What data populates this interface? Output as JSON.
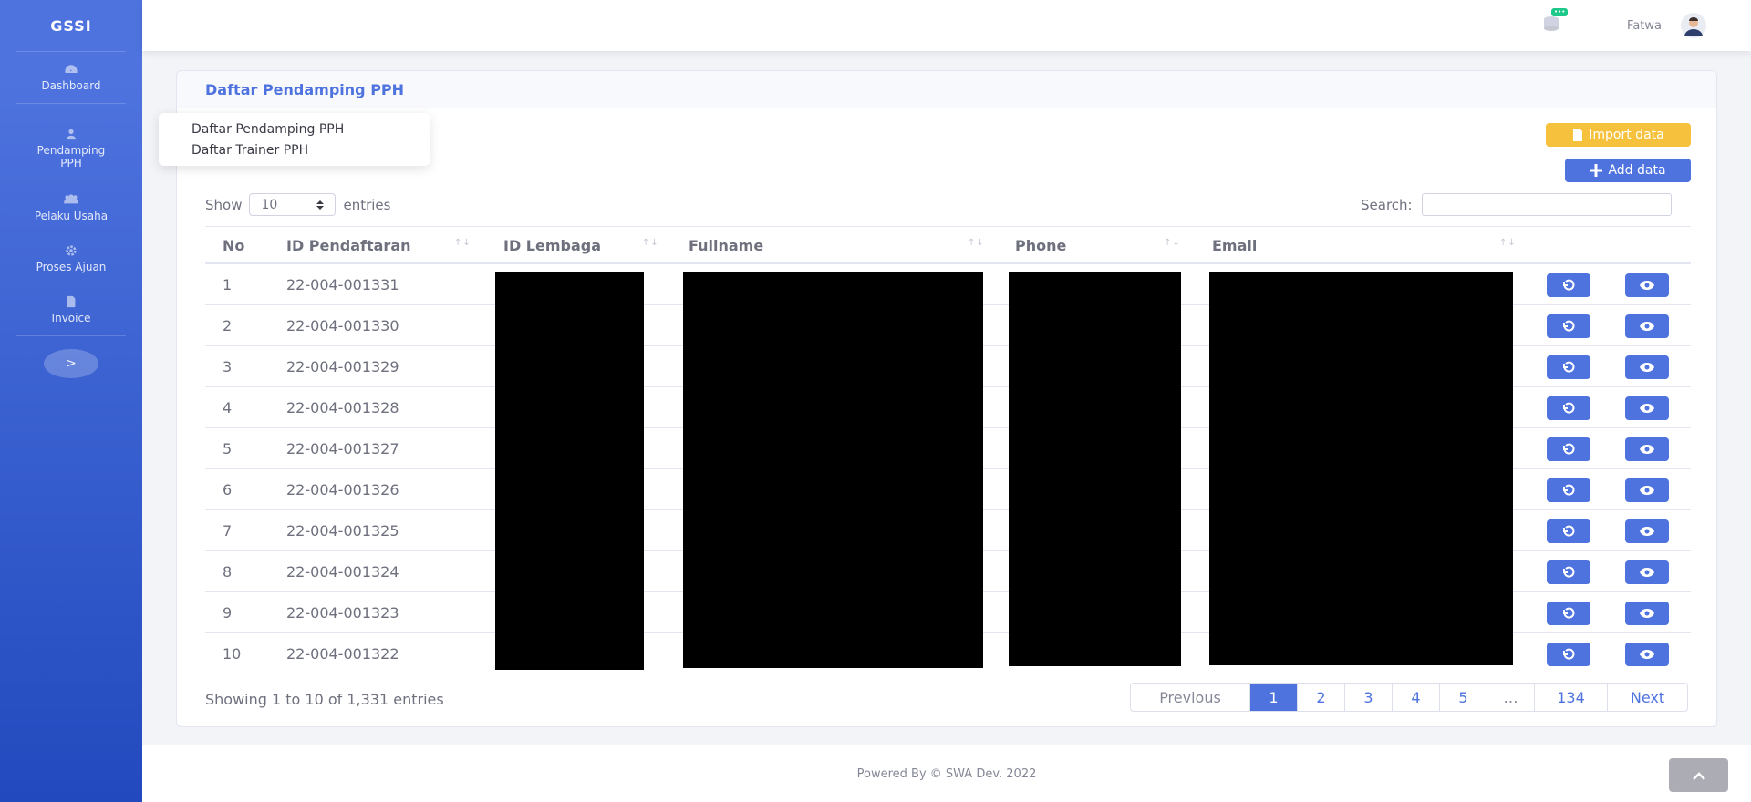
{
  "app": {
    "brand": "GSSI"
  },
  "sidebar": {
    "items": [
      {
        "label": "Dashboard",
        "icon": "tachometer-icon"
      },
      {
        "label": "Pendamping PPH",
        "icon": "user-icon"
      },
      {
        "label": "Pelaku Usaha",
        "icon": "users-icon"
      },
      {
        "label": "Proses Ajuan",
        "icon": "cog-icon"
      },
      {
        "label": "Invoice",
        "icon": "file-icon"
      }
    ],
    "toggle_label": ">"
  },
  "topbar": {
    "badge": "•••",
    "username": "Fatwa"
  },
  "submenu": {
    "items": [
      "Daftar Pendamping PPH",
      "Daftar Trainer PPH"
    ]
  },
  "card": {
    "title": "Daftar Pendamping PPH",
    "import_label": "Import data",
    "add_label": "Add data"
  },
  "controls": {
    "show_label": "Show",
    "entries_value": "10",
    "entries_label": "entries",
    "search_label": "Search:",
    "search_value": ""
  },
  "table": {
    "columns": [
      "No",
      "ID Pendaftaran",
      "ID Lembaga",
      "Fullname",
      "Phone",
      "Email"
    ],
    "rows": [
      {
        "no": "1",
        "id": "22-004-001331"
      },
      {
        "no": "2",
        "id": "22-004-001330"
      },
      {
        "no": "3",
        "id": "22-004-001329"
      },
      {
        "no": "4",
        "id": "22-004-001328"
      },
      {
        "no": "5",
        "id": "22-004-001327"
      },
      {
        "no": "6",
        "id": "22-004-001326"
      },
      {
        "no": "7",
        "id": "22-004-001325"
      },
      {
        "no": "8",
        "id": "22-004-001324"
      },
      {
        "no": "9",
        "id": "22-004-001323"
      },
      {
        "no": "10",
        "id": "22-004-001322"
      }
    ]
  },
  "pagination": {
    "info": "Showing 1 to 10 of 1,331 entries",
    "previous": "Previous",
    "pages": [
      "1",
      "2",
      "3",
      "4",
      "5",
      "…",
      "134"
    ],
    "active_page": "1",
    "next": "Next"
  },
  "footer": {
    "text": "Powered By © SWA Dev. 2022"
  },
  "colors": {
    "primary": "#4e73df",
    "warning": "#f6c23e",
    "success": "#1cc88a",
    "redaction": "#000000"
  }
}
